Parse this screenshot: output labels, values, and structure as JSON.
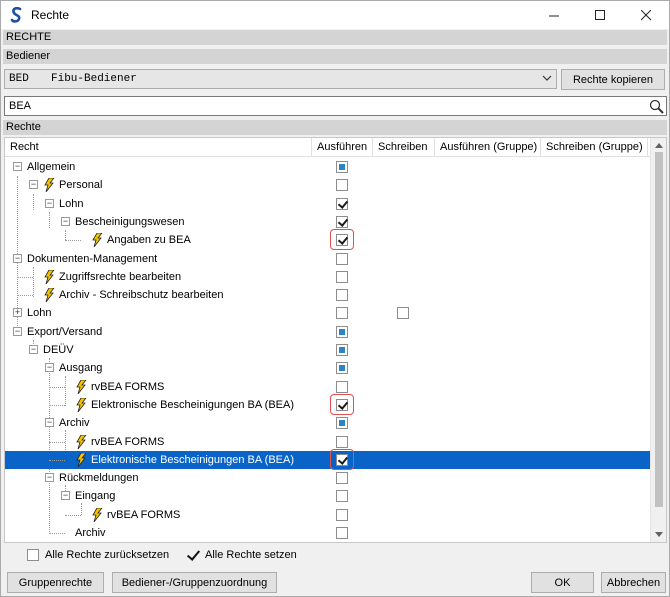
{
  "window": {
    "title": "Rechte"
  },
  "sections": {
    "top": "RECHTE",
    "user": "Bediener",
    "rights": "Rechte"
  },
  "combo": {
    "code": "BED",
    "name": "Fibu-Bediener"
  },
  "buttons": {
    "copy": "Rechte kopieren",
    "group_rights": "Gruppenrechte",
    "assign": "Bediener-/Gruppenzuordnung",
    "ok": "OK",
    "cancel": "Abbrechen"
  },
  "search": {
    "value": "BEA"
  },
  "columns": [
    "Recht",
    "Ausführen",
    "Schreiben",
    "Ausführen (Gruppe)",
    "Schreiben (Gruppe)"
  ],
  "tree": [
    {
      "label": "Allgemein",
      "run": "partial"
    },
    {
      "label": "Personal",
      "run": "unchecked"
    },
    {
      "label": "Lohn",
      "run": "checked"
    },
    {
      "label": "Bescheinigungswesen",
      "run": "checked"
    },
    {
      "label": "Angaben zu BEA",
      "run": "checked"
    },
    {
      "label": "Dokumenten-Management",
      "run": "unchecked"
    },
    {
      "label": "Zugriffsrechte bearbeiten",
      "run": "unchecked"
    },
    {
      "label": "Archiv - Schreibschutz bearbeiten",
      "run": "unchecked"
    },
    {
      "label": "Lohn",
      "run": "unchecked",
      "write": "unchecked"
    },
    {
      "label": "Export/Versand",
      "run": "partial"
    },
    {
      "label": "DEÜV",
      "run": "partial"
    },
    {
      "label": "Ausgang",
      "run": "partial"
    },
    {
      "label": "rvBEA FORMS",
      "run": "unchecked"
    },
    {
      "label": "Elektronische Bescheinigungen BA (BEA)",
      "run": "checked"
    },
    {
      "label": "Archiv",
      "run": "partial"
    },
    {
      "label": "rvBEA FORMS",
      "run": "unchecked"
    },
    {
      "label": "Elektronische Bescheinigungen BA (BEA)",
      "run": "checked"
    },
    {
      "label": "Rückmeldungen",
      "run": "unchecked"
    },
    {
      "label": "Eingang",
      "run": "unchecked"
    },
    {
      "label": "rvBEA FORMS",
      "run": "unchecked"
    },
    {
      "label": "Archiv",
      "run": "unchecked"
    }
  ],
  "options": {
    "reset_all": "Alle Rechte zurücksetzen",
    "set_all": "Alle Rechte setzen",
    "set_all_checked": true
  },
  "colors": {
    "selection": "#0a64c8",
    "highlight": "#e05050",
    "partial": "#2b84c7"
  }
}
